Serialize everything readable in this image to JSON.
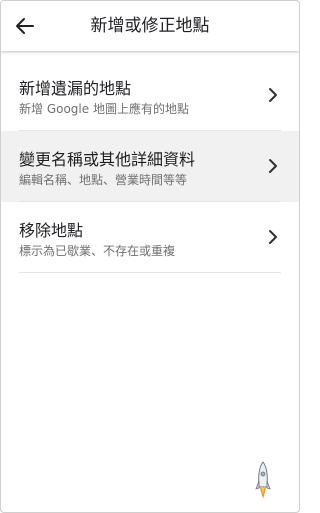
{
  "appbar": {
    "title": "新增或修正地點",
    "back_icon": "arrow-left-icon"
  },
  "items": [
    {
      "title": "新增遺漏的地點",
      "subtitle": "新增 Google 地圖上應有的地點",
      "icon": "chevron-right-icon",
      "selected": false
    },
    {
      "title": "變更名稱或其他詳細資料",
      "subtitle": "編輯名稱、地點、營業時間等等",
      "icon": "chevron-right-icon",
      "selected": true
    },
    {
      "title": "移除地點",
      "subtitle": "標示為已歇業、不存在或重複",
      "icon": "chevron-right-icon",
      "selected": false
    }
  ],
  "decor": {
    "corner_icon": "rocket-icon"
  },
  "colors": {
    "text_primary": "#202124",
    "text_secondary": "#707070",
    "selected_bg": "#f1f1f1",
    "divider": "#e4e4e4"
  }
}
